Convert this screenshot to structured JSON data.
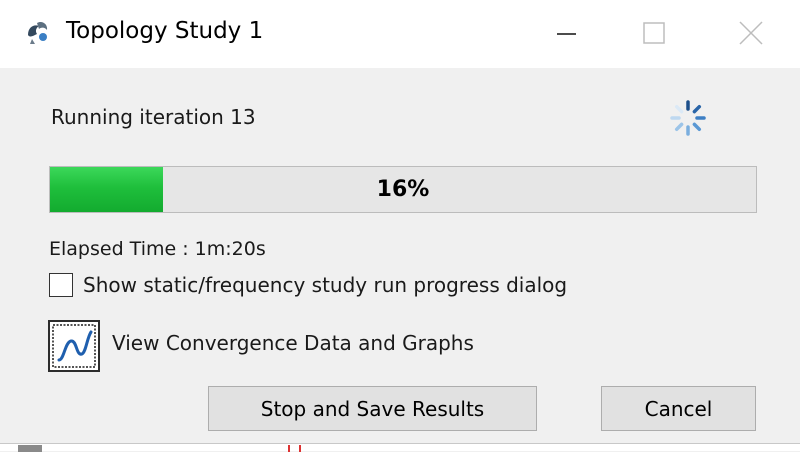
{
  "window": {
    "title": "Topology Study 1",
    "app_icon": "topology-study-icon",
    "controls": [
      "minimize-icon",
      "maximize-icon",
      "close-icon"
    ]
  },
  "status": {
    "text": "Running iteration 13",
    "spinner_icon": "loading-spinner-icon"
  },
  "progress": {
    "percent": 16,
    "label": "16%",
    "fill_color": "#1fbf3c"
  },
  "elapsed": "Elapsed Time : 1m:20s",
  "options": {
    "show_progress_dialog": {
      "label": "Show static/frequency study run progress dialog",
      "checked": false
    }
  },
  "convergence": {
    "label": "View Convergence Data and Graphs",
    "icon": "convergence-graph-icon"
  },
  "buttons": {
    "stop_save": "Stop and Save Results",
    "cancel": "Cancel"
  }
}
